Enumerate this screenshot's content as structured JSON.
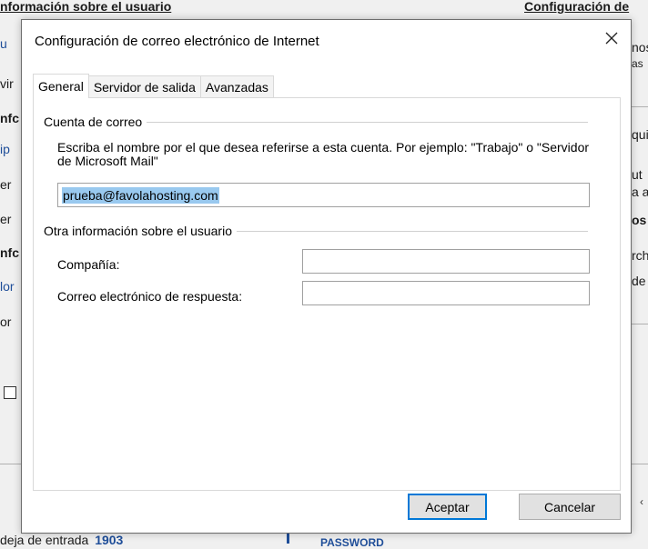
{
  "background": {
    "left_title": "nformación sobre el usuario",
    "right_title": "Configuración de",
    "left_fragments": [
      "u",
      "vir",
      "nfc",
      "ip",
      "er",
      "er",
      "nfc",
      "lor",
      "or"
    ],
    "right_fragments": [
      "nos",
      "as",
      "qui",
      "ut",
      "a a",
      "os",
      "rch",
      "de"
    ],
    "bottom_left": "deja de entrada",
    "bottom_left_count": "1903",
    "bottom_right": "PASSWORD"
  },
  "dialog": {
    "title": "Configuración de correo electrónico de Internet",
    "tabs": [
      "General",
      "Servidor de salida",
      "Avanzadas"
    ],
    "account_group": "Cuenta de correo",
    "account_description": "Escriba el nombre por el que desea referirse a esta cuenta. Por ejemplo: \"Trabajo\" o \"Servidor de Microsoft Mail\"",
    "account_value": "prueba@favolahosting.com",
    "other_group": "Otra información sobre el usuario",
    "company_label": "Compañía:",
    "company_value": "",
    "reply_label": "Correo electrónico de respuesta:",
    "reply_value": "",
    "ok_label": "Aceptar",
    "cancel_label": "Cancelar"
  }
}
